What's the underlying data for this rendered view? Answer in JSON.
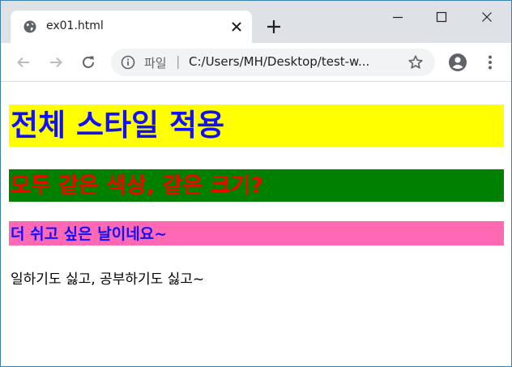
{
  "tab": {
    "title": "ex01.html",
    "favicon": "globe-icon"
  },
  "toolbar": {
    "scheme_label": "파일",
    "url": "C:/Users/MH/Desktop/test-w..."
  },
  "content": {
    "h1": "전체 스타일 적용",
    "h2": "모두 같은 색상, 같은 크기?",
    "h3": "더 쉬고 싶은 날이네요~",
    "paragraph": "일하기도 싫고, 공부하기도 싫고~"
  },
  "colors": {
    "h1_bg": "#ffff00",
    "h1_fg": "#1010ff",
    "h2_bg": "#008000",
    "h2_fg": "#ff0000",
    "h3_bg": "#ff69b4",
    "h3_fg": "#1010ff",
    "tabstrip_bg": "#dee1e6"
  }
}
